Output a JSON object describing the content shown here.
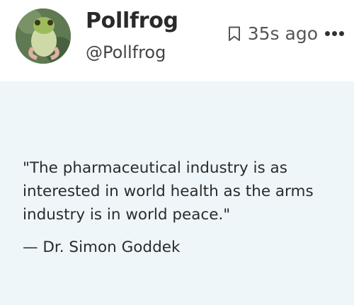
{
  "post": {
    "author_name": "Pollfrog",
    "author_handle": "@Pollfrog",
    "timestamp": "35s ago",
    "quote_text": "\"The pharmaceutical industry is as interested in world health as the arms industry is in world peace.\"",
    "attribution": "— Dr. Simon Goddek"
  },
  "icons": {
    "bookmark": "bookmark-icon",
    "more": "more-options-icon"
  },
  "colors": {
    "content_background": "#eef6fa",
    "header_background": "#ffffff",
    "text": "#2b2b2b"
  }
}
